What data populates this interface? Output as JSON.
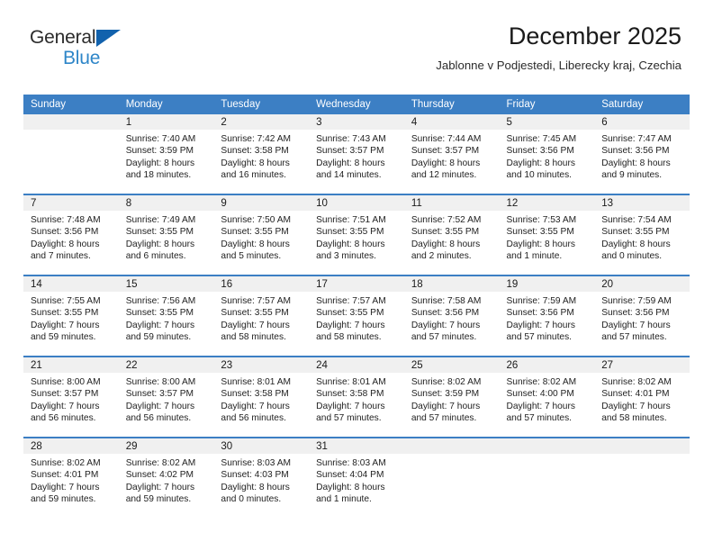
{
  "brand": {
    "line1": "General",
    "line2": "Blue",
    "triangle_color": "#1262ad",
    "line2_color": "#2e86c8"
  },
  "header": {
    "title": "December 2025",
    "subtitle": "Jablonne v Podjestedi, Liberecky kraj, Czechia"
  },
  "theme": {
    "header_bg": "#3c7fc4",
    "daynum_bg": "#f0f0f0",
    "text": "#222222"
  },
  "weekdays": [
    "Sunday",
    "Monday",
    "Tuesday",
    "Wednesday",
    "Thursday",
    "Friday",
    "Saturday"
  ],
  "weeks": [
    [
      {
        "day": "",
        "empty": true,
        "sunrise": "",
        "sunset": "",
        "daylight1": "",
        "daylight2": ""
      },
      {
        "day": "1",
        "empty": false,
        "sunrise": "Sunrise: 7:40 AM",
        "sunset": "Sunset: 3:59 PM",
        "daylight1": "Daylight: 8 hours",
        "daylight2": "and 18 minutes."
      },
      {
        "day": "2",
        "empty": false,
        "sunrise": "Sunrise: 7:42 AM",
        "sunset": "Sunset: 3:58 PM",
        "daylight1": "Daylight: 8 hours",
        "daylight2": "and 16 minutes."
      },
      {
        "day": "3",
        "empty": false,
        "sunrise": "Sunrise: 7:43 AM",
        "sunset": "Sunset: 3:57 PM",
        "daylight1": "Daylight: 8 hours",
        "daylight2": "and 14 minutes."
      },
      {
        "day": "4",
        "empty": false,
        "sunrise": "Sunrise: 7:44 AM",
        "sunset": "Sunset: 3:57 PM",
        "daylight1": "Daylight: 8 hours",
        "daylight2": "and 12 minutes."
      },
      {
        "day": "5",
        "empty": false,
        "sunrise": "Sunrise: 7:45 AM",
        "sunset": "Sunset: 3:56 PM",
        "daylight1": "Daylight: 8 hours",
        "daylight2": "and 10 minutes."
      },
      {
        "day": "6",
        "empty": false,
        "sunrise": "Sunrise: 7:47 AM",
        "sunset": "Sunset: 3:56 PM",
        "daylight1": "Daylight: 8 hours",
        "daylight2": "and 9 minutes."
      }
    ],
    [
      {
        "day": "7",
        "empty": false,
        "sunrise": "Sunrise: 7:48 AM",
        "sunset": "Sunset: 3:56 PM",
        "daylight1": "Daylight: 8 hours",
        "daylight2": "and 7 minutes."
      },
      {
        "day": "8",
        "empty": false,
        "sunrise": "Sunrise: 7:49 AM",
        "sunset": "Sunset: 3:55 PM",
        "daylight1": "Daylight: 8 hours",
        "daylight2": "and 6 minutes."
      },
      {
        "day": "9",
        "empty": false,
        "sunrise": "Sunrise: 7:50 AM",
        "sunset": "Sunset: 3:55 PM",
        "daylight1": "Daylight: 8 hours",
        "daylight2": "and 5 minutes."
      },
      {
        "day": "10",
        "empty": false,
        "sunrise": "Sunrise: 7:51 AM",
        "sunset": "Sunset: 3:55 PM",
        "daylight1": "Daylight: 8 hours",
        "daylight2": "and 3 minutes."
      },
      {
        "day": "11",
        "empty": false,
        "sunrise": "Sunrise: 7:52 AM",
        "sunset": "Sunset: 3:55 PM",
        "daylight1": "Daylight: 8 hours",
        "daylight2": "and 2 minutes."
      },
      {
        "day": "12",
        "empty": false,
        "sunrise": "Sunrise: 7:53 AM",
        "sunset": "Sunset: 3:55 PM",
        "daylight1": "Daylight: 8 hours",
        "daylight2": "and 1 minute."
      },
      {
        "day": "13",
        "empty": false,
        "sunrise": "Sunrise: 7:54 AM",
        "sunset": "Sunset: 3:55 PM",
        "daylight1": "Daylight: 8 hours",
        "daylight2": "and 0 minutes."
      }
    ],
    [
      {
        "day": "14",
        "empty": false,
        "sunrise": "Sunrise: 7:55 AM",
        "sunset": "Sunset: 3:55 PM",
        "daylight1": "Daylight: 7 hours",
        "daylight2": "and 59 minutes."
      },
      {
        "day": "15",
        "empty": false,
        "sunrise": "Sunrise: 7:56 AM",
        "sunset": "Sunset: 3:55 PM",
        "daylight1": "Daylight: 7 hours",
        "daylight2": "and 59 minutes."
      },
      {
        "day": "16",
        "empty": false,
        "sunrise": "Sunrise: 7:57 AM",
        "sunset": "Sunset: 3:55 PM",
        "daylight1": "Daylight: 7 hours",
        "daylight2": "and 58 minutes."
      },
      {
        "day": "17",
        "empty": false,
        "sunrise": "Sunrise: 7:57 AM",
        "sunset": "Sunset: 3:55 PM",
        "daylight1": "Daylight: 7 hours",
        "daylight2": "and 58 minutes."
      },
      {
        "day": "18",
        "empty": false,
        "sunrise": "Sunrise: 7:58 AM",
        "sunset": "Sunset: 3:56 PM",
        "daylight1": "Daylight: 7 hours",
        "daylight2": "and 57 minutes."
      },
      {
        "day": "19",
        "empty": false,
        "sunrise": "Sunrise: 7:59 AM",
        "sunset": "Sunset: 3:56 PM",
        "daylight1": "Daylight: 7 hours",
        "daylight2": "and 57 minutes."
      },
      {
        "day": "20",
        "empty": false,
        "sunrise": "Sunrise: 7:59 AM",
        "sunset": "Sunset: 3:56 PM",
        "daylight1": "Daylight: 7 hours",
        "daylight2": "and 57 minutes."
      }
    ],
    [
      {
        "day": "21",
        "empty": false,
        "sunrise": "Sunrise: 8:00 AM",
        "sunset": "Sunset: 3:57 PM",
        "daylight1": "Daylight: 7 hours",
        "daylight2": "and 56 minutes."
      },
      {
        "day": "22",
        "empty": false,
        "sunrise": "Sunrise: 8:00 AM",
        "sunset": "Sunset: 3:57 PM",
        "daylight1": "Daylight: 7 hours",
        "daylight2": "and 56 minutes."
      },
      {
        "day": "23",
        "empty": false,
        "sunrise": "Sunrise: 8:01 AM",
        "sunset": "Sunset: 3:58 PM",
        "daylight1": "Daylight: 7 hours",
        "daylight2": "and 56 minutes."
      },
      {
        "day": "24",
        "empty": false,
        "sunrise": "Sunrise: 8:01 AM",
        "sunset": "Sunset: 3:58 PM",
        "daylight1": "Daylight: 7 hours",
        "daylight2": "and 57 minutes."
      },
      {
        "day": "25",
        "empty": false,
        "sunrise": "Sunrise: 8:02 AM",
        "sunset": "Sunset: 3:59 PM",
        "daylight1": "Daylight: 7 hours",
        "daylight2": "and 57 minutes."
      },
      {
        "day": "26",
        "empty": false,
        "sunrise": "Sunrise: 8:02 AM",
        "sunset": "Sunset: 4:00 PM",
        "daylight1": "Daylight: 7 hours",
        "daylight2": "and 57 minutes."
      },
      {
        "day": "27",
        "empty": false,
        "sunrise": "Sunrise: 8:02 AM",
        "sunset": "Sunset: 4:01 PM",
        "daylight1": "Daylight: 7 hours",
        "daylight2": "and 58 minutes."
      }
    ],
    [
      {
        "day": "28",
        "empty": false,
        "sunrise": "Sunrise: 8:02 AM",
        "sunset": "Sunset: 4:01 PM",
        "daylight1": "Daylight: 7 hours",
        "daylight2": "and 59 minutes."
      },
      {
        "day": "29",
        "empty": false,
        "sunrise": "Sunrise: 8:02 AM",
        "sunset": "Sunset: 4:02 PM",
        "daylight1": "Daylight: 7 hours",
        "daylight2": "and 59 minutes."
      },
      {
        "day": "30",
        "empty": false,
        "sunrise": "Sunrise: 8:03 AM",
        "sunset": "Sunset: 4:03 PM",
        "daylight1": "Daylight: 8 hours",
        "daylight2": "and 0 minutes."
      },
      {
        "day": "31",
        "empty": false,
        "sunrise": "Sunrise: 8:03 AM",
        "sunset": "Sunset: 4:04 PM",
        "daylight1": "Daylight: 8 hours",
        "daylight2": "and 1 minute."
      },
      {
        "day": "",
        "empty": true,
        "sunrise": "",
        "sunset": "",
        "daylight1": "",
        "daylight2": ""
      },
      {
        "day": "",
        "empty": true,
        "sunrise": "",
        "sunset": "",
        "daylight1": "",
        "daylight2": ""
      },
      {
        "day": "",
        "empty": true,
        "sunrise": "",
        "sunset": "",
        "daylight1": "",
        "daylight2": ""
      }
    ]
  ]
}
